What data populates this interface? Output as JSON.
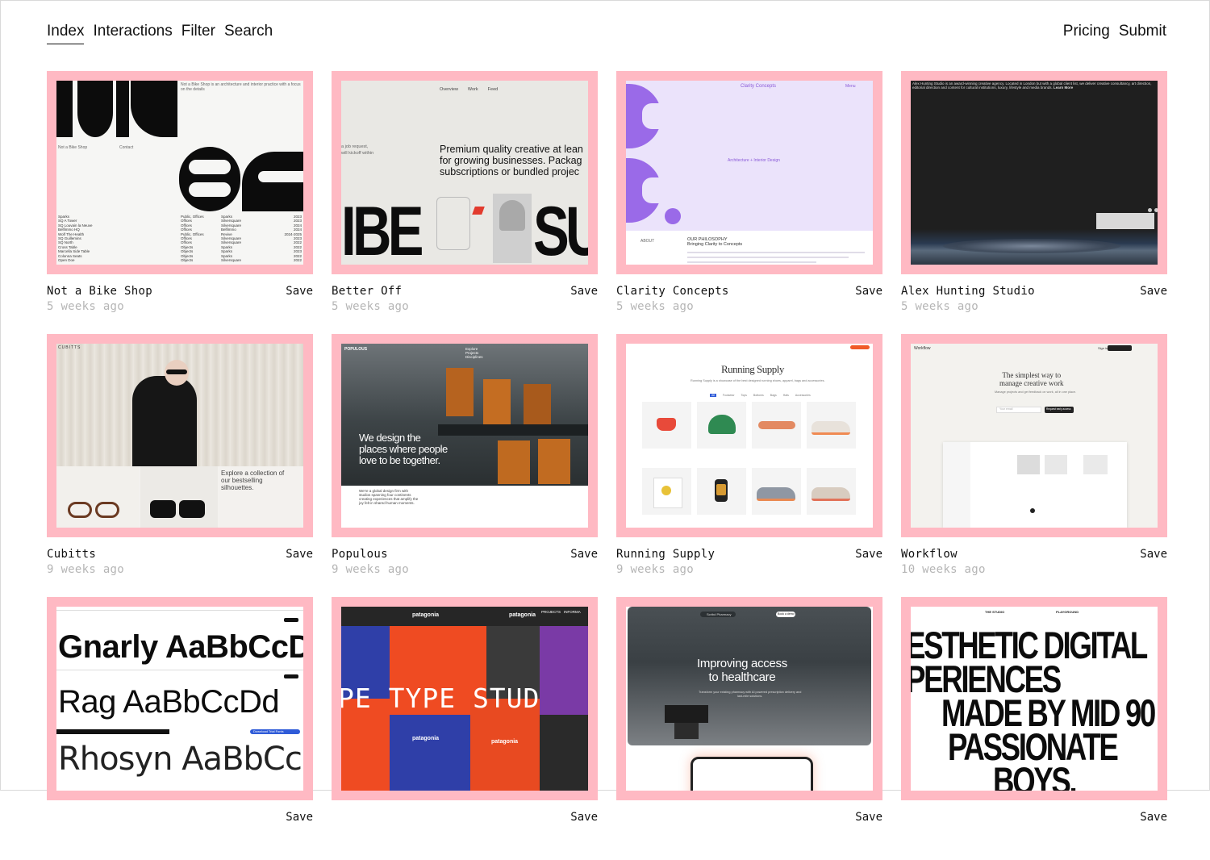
{
  "nav": {
    "left": [
      {
        "label": "Index",
        "active": true
      },
      {
        "label": "Interactions"
      },
      {
        "label": "Filter"
      },
      {
        "label": "Search"
      }
    ],
    "right": [
      {
        "label": "Pricing"
      },
      {
        "label": "Submit"
      }
    ]
  },
  "save_label": "Save",
  "accent_color": "#ffb9c3",
  "cards": [
    {
      "title": "Not a Bike Shop",
      "age": "5 weeks ago",
      "list": [
        "Sparks",
        "SQ A Tower",
        "SQ Louvain la Neuve",
        "Belfimmo HQ",
        "Wolf The Health",
        "SQ Guillemins",
        "SQ North",
        "Cross Table",
        "Marcella Side Table",
        "Colonna Seats",
        "Open Doe"
      ],
      "list2": [
        "Public, Offices",
        "Offices",
        "Offices",
        "Offices",
        "Public, Offices",
        "Offices",
        "Offices",
        "Objects",
        "Objects",
        "Objects",
        "Objects"
      ],
      "list3": [
        "Sparks",
        "Silversquare",
        "Silversquare",
        "Belfimmo",
        "Revive",
        "Silversquare",
        "Silversquare",
        "Sparks",
        "Sparks",
        "Sparks",
        "Silversquare"
      ],
      "years": [
        "2023",
        "2023",
        "2024",
        "2024",
        "2024-2025",
        "2023",
        "2022",
        "2022",
        "2023",
        "2022",
        "2022"
      ]
    },
    {
      "title": "Better Off",
      "age": "5 weeks ago",
      "tabs": [
        "Overview",
        "Work",
        "Feed"
      ],
      "headline": [
        "Premium quality creative at lean",
        "for growing businesses. Packag",
        "subscriptions or bundled projec"
      ],
      "side": [
        "a job request,",
        "will kickoff within"
      ],
      "big_left": "IBE",
      "big_right": "SU"
    },
    {
      "title": "Clarity Concepts",
      "age": "5 weeks ago",
      "brand": "Clarity Concepts",
      "menu": "Menu",
      "tagline": "Architecture + Interior Design",
      "philosophy": "OUR PHILOSOPHY",
      "philosophy_sub": "Bringing Clarity to Concepts",
      "about": "ABOUT"
    },
    {
      "title": "Alex Hunting Studio",
      "age": "5 weeks ago",
      "intro": "Alex Hunting Studio is an award-winning creative agency. Located in London but with a global client list, we deliver creative consultancy, art direction, editorial direction and content for cultural institutions, luxury, lifestyle and media brands.",
      "learn_more": "Learn More"
    },
    {
      "title": "Cubitts",
      "age": "9 weeks ago",
      "logo": "CUBITTS",
      "caption": [
        "Explore a collection of",
        "our bestselling",
        "silhouettes."
      ]
    },
    {
      "title": "Populous",
      "age": "9 weeks ago",
      "logo": "POPULOUS",
      "menu": [
        "Explore",
        "Projects",
        "Disciplines"
      ],
      "headline": [
        "We design the",
        "places where people",
        "love to be together."
      ],
      "body": [
        "We're a global design firm with",
        "studios spanning four continents",
        "creating experiences that amplify the",
        "joy felt in shared human moments."
      ]
    },
    {
      "title": "Running Supply",
      "age": "9 weeks ago",
      "brand": "Running Supply",
      "sub": "Running Supply is a showcase of the best designed running shoes, apparel, bags and accessories.",
      "filters": [
        "All",
        "Footwear",
        "Tops",
        "Bottoms",
        "Bags",
        "Hats",
        "Accessories"
      ]
    },
    {
      "title": "Workflow",
      "age": "10 weeks ago",
      "logo": "Workflow",
      "headline": [
        "The simplest way to",
        "manage creative work"
      ],
      "sub": "Manage projects and get feedback on work, all in one place.",
      "input_placeholder": "Your email",
      "cta": "Request early access",
      "signin": "Sign in"
    },
    {
      "title": "",
      "age": "",
      "lines": [
        "Gnarly AaBbCcDd",
        "Rag AaBbCcDd",
        "Rhosyn AaBbCc"
      ],
      "download": "Download Trial Fonts"
    },
    {
      "title": "",
      "age": "",
      "brand": "patagonia",
      "overlay": "PE TYPE STUD",
      "nav": [
        "PROJECTS",
        "INFORMA"
      ]
    },
    {
      "title": "",
      "age": "",
      "headline": [
        "Improving access",
        "to healthcare"
      ],
      "sub": [
        "Transform your existing pharmacy with AI powered prescription delivery and",
        "last-mile solutions."
      ],
      "pill": "Scribd Pharmacy",
      "cta": "Book a demo"
    },
    {
      "title": "",
      "age": "",
      "lines": [
        "ESTHETIC DIGITAL",
        "PERIENCES",
        "MADE BY MID 90",
        "PASSIONATE",
        "BOYS."
      ],
      "nav": [
        "THE STUDIO",
        "PLAYGROUND"
      ]
    }
  ]
}
